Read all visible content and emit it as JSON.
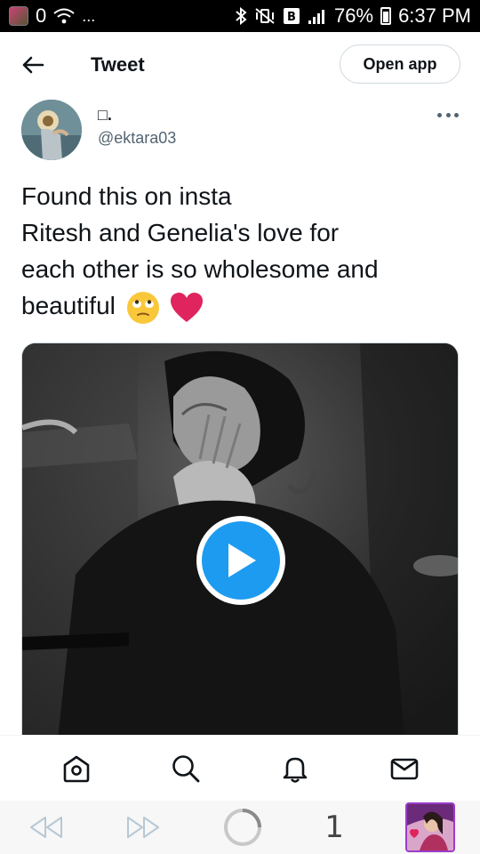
{
  "status_bar": {
    "zero": "0",
    "dots": "...",
    "battery_percent": "76%",
    "time": "6:37 PM"
  },
  "header": {
    "title": "Tweet",
    "open_app_label": "Open app"
  },
  "tweet": {
    "display_name": "□.",
    "handle": "@ektara03",
    "text_lines": [
      "Found this on insta",
      "Ritesh and Genelia's love for",
      "each other is so wholesome and",
      "beautiful"
    ]
  },
  "browser_bar": {
    "tab_count": "1"
  },
  "icons": {
    "back": "arrow-left-icon",
    "more": "more-dots-icon",
    "play": "play-icon",
    "home": "home-icon",
    "search": "search-icon",
    "notifications": "bell-icon",
    "messages": "mail-icon",
    "browser_back": "rewind-icon",
    "browser_forward": "fast-forward-icon",
    "loading": "loading-spinner-icon"
  },
  "colors": {
    "accent": "#1d9bf0",
    "text": "#0f1419",
    "secondary_text": "#536471",
    "heart": "#e0245e"
  }
}
